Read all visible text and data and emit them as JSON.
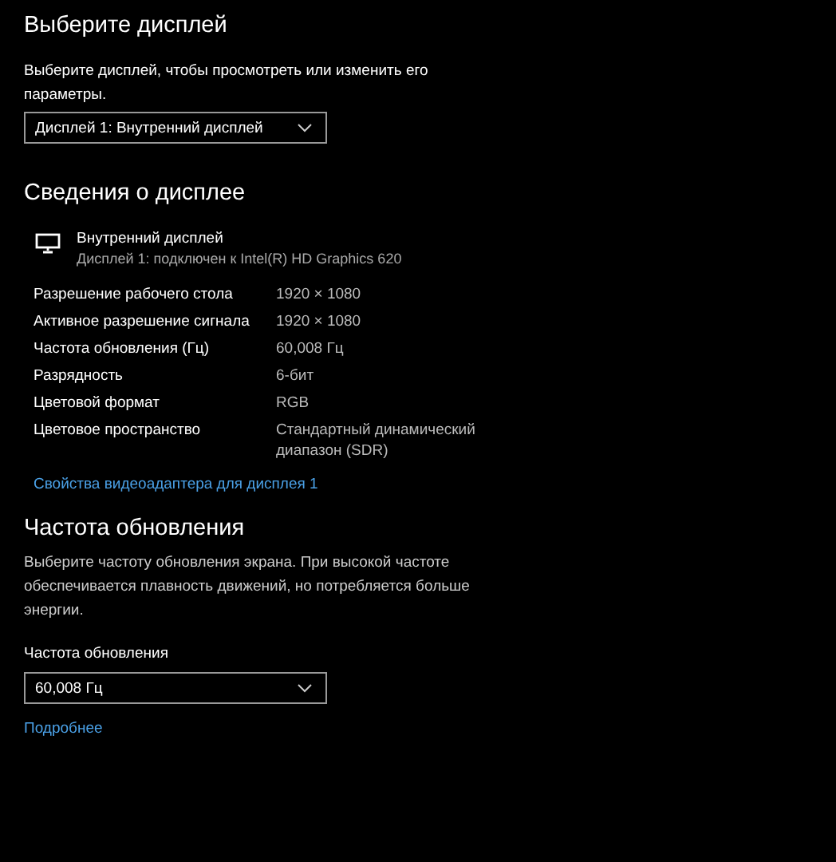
{
  "select_display": {
    "title": "Выберите дисплей",
    "description": "Выберите дисплей, чтобы просмотреть или изменить его параметры.",
    "dropdown": {
      "value": "Дисплей 1: Внутренний дисплей"
    }
  },
  "display_info": {
    "title": "Сведения о дисплее",
    "display_name": "Внутренний дисплей",
    "display_subtitle": "Дисплей 1: подключен к Intel(R) HD Graphics 620",
    "rows": [
      {
        "label": "Разрешение рабочего стола",
        "value": "1920 × 1080"
      },
      {
        "label": "Активное разрешение сигнала",
        "value": "1920 × 1080"
      },
      {
        "label": "Частота обновления (Гц)",
        "value": "60,008 Гц"
      },
      {
        "label": "Разрядность",
        "value": "6-бит"
      },
      {
        "label": "Цветовой формат",
        "value": "RGB"
      },
      {
        "label": "Цветовое пространство",
        "value": "Стандартный динамический диапазон (SDR)"
      }
    ],
    "link": "Свойства видеоадаптера для дисплея 1"
  },
  "refresh_rate": {
    "title": "Частота обновления",
    "description": "Выберите частоту обновления экрана. При высокой частоте обеспечивается плавность движений, но потребляется больше энергии.",
    "field_label": "Частота обновления",
    "dropdown": {
      "value": "60,008 Гц"
    },
    "link": "Подробнее"
  }
}
